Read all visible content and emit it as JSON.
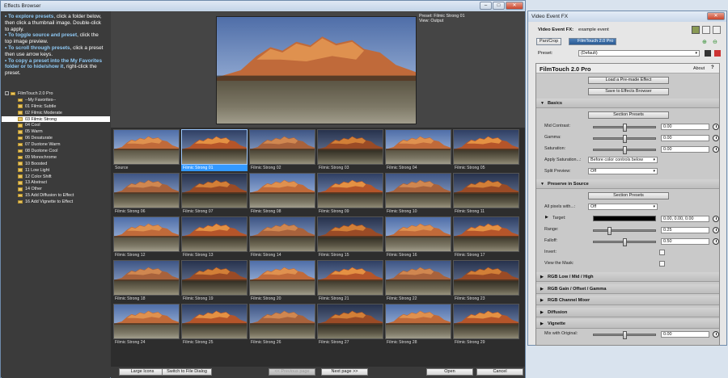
{
  "effects_browser": {
    "title": "Effects Browser",
    "help": [
      {
        "bold": "To explore presets",
        "rest": ", click a folder below, then click a thumbnail image. Double-click to apply."
      },
      {
        "bold": "To toggle source and preset",
        "rest": ", click the top image preview."
      },
      {
        "bold": "To scroll through presets",
        "rest": ", click a preset then use arrow keys."
      },
      {
        "bold": "To copy a preset into the My Favorites folder or to hide/show it",
        "rest": ", right-click the preset."
      }
    ],
    "tree": [
      {
        "label": "FilmTouch 2.0 Pro",
        "root": true
      },
      {
        "label": "--My Favorites--"
      },
      {
        "label": "01 Filmic Subtle"
      },
      {
        "label": "02 Filmic Moderate"
      },
      {
        "label": "03 Filmic Strong",
        "selected": true
      },
      {
        "label": "04 Cool"
      },
      {
        "label": "05 Warm"
      },
      {
        "label": "06 Desaturate"
      },
      {
        "label": "07 Duotone Warm"
      },
      {
        "label": "08 Duotone Cool"
      },
      {
        "label": "09 Monochrome"
      },
      {
        "label": "10 Boosted"
      },
      {
        "label": "11 Low Light"
      },
      {
        "label": "12 Color Shift"
      },
      {
        "label": "13 Abstract"
      },
      {
        "label": "14 Other"
      },
      {
        "label": "15 Add Diffusion to Effect"
      },
      {
        "label": "16 Add Vignette to Effect"
      }
    ],
    "preview_info": [
      "Preset: Filmic Strong 01",
      "View: Output"
    ],
    "thumbnails": [
      "Source",
      "Filmic Strong 01",
      "Filmic Strong 02",
      "Filmic Strong 03",
      "Filmic Strong 04",
      "Filmic Strong 05",
      "Filmic Strong 06",
      "Filmic Strong 07",
      "Filmic Strong 08",
      "Filmic Strong 09",
      "Filmic Strong 10",
      "Filmic Strong 11",
      "Filmic Strong 12",
      "Filmic Strong 13",
      "Filmic Strong 14",
      "Filmic Strong 15",
      "Filmic Strong 16",
      "Filmic Strong 17",
      "Filmic Strong 18",
      "Filmic Strong 19",
      "Filmic Strong 20",
      "Filmic Strong 21",
      "Filmic Strong 22",
      "Filmic Strong 23",
      "Filmic Strong 24",
      "Filmic Strong 25",
      "Filmic Strong 26",
      "Filmic Strong 27",
      "Filmic Strong 28",
      "Filmic Strong 29"
    ],
    "selected_thumbnail": "Filmic Strong 01",
    "buttons": {
      "large_icons": "Large Icons",
      "switch_dialog": "Switch to File Dialog",
      "prev_page": "<< Previous page",
      "next_page": "Next page >>",
      "open": "Open",
      "cancel": "Cancel"
    }
  },
  "video_fx": {
    "title": "Video Event FX",
    "event_label": "Video Event FX:",
    "event_name": "example event",
    "chain": [
      "Pan/Crop",
      "FilmTouch 2.0 Pro"
    ],
    "preset_label": "Preset:",
    "preset_value": "(Default)",
    "plugin_name": "FilmTouch 2.0 Pro",
    "about": "About",
    "help_q": "?",
    "load_button": "Load a Pre-made Effect",
    "save_button": "Save to Effects Browser",
    "basics": {
      "title": "Basics",
      "section_presets": "Section Presets",
      "mid_contrast": {
        "label": "Mid Contrast:",
        "value": "0.00"
      },
      "gamma": {
        "label": "Gamma:",
        "value": "0.00"
      },
      "saturation": {
        "label": "Saturation:",
        "value": "0.00"
      },
      "apply_saturation": {
        "label": "Apply Saturation...:",
        "value": "Before color controls below"
      },
      "split_preview": {
        "label": "Split Preview:",
        "value": "Off"
      }
    },
    "preserve": {
      "title": "Preserve in Source",
      "section_presets": "Section Presets",
      "all_pixels": {
        "label": "All pixels with...:",
        "value": "Off"
      },
      "target": {
        "label": "Target:",
        "value": "0.00, 0.00, 0.00"
      },
      "range": {
        "label": "Range:",
        "value": "0.25"
      },
      "falloff": {
        "label": "Falloff:",
        "value": "0.50"
      },
      "invert": {
        "label": "Invert:"
      },
      "view_mask": {
        "label": "View the Mask:"
      }
    },
    "collapsed_sections": [
      "RGB Low / Mid / High",
      "RGB Gain / Offset / Gamma",
      "RGB Channel Mixer",
      "Diffusion",
      "Vignette"
    ],
    "mix": {
      "label": "Mix with Original:",
      "value": "0.00"
    }
  }
}
